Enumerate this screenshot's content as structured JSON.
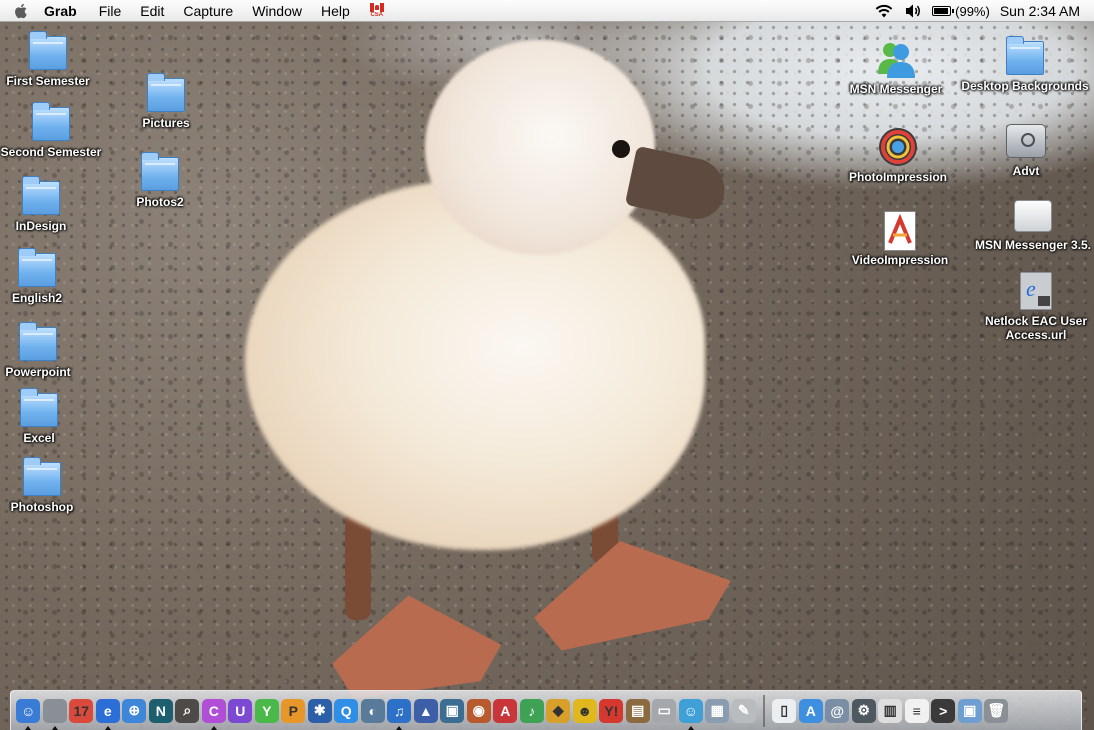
{
  "menubar": {
    "app_name": "Grab",
    "menus": [
      "File",
      "Edit",
      "Capture",
      "Window",
      "Help"
    ],
    "flag_label": "CSA",
    "battery": "(99%)",
    "battery_level": 0.99,
    "clock": "Sun 2:34 AM"
  },
  "desktop": {
    "left_icons": [
      {
        "label": "First Semester",
        "type": "folder"
      },
      {
        "label": "Second Semester",
        "type": "folder"
      },
      {
        "label": "InDesign",
        "type": "folder"
      },
      {
        "label": "English2",
        "type": "folder"
      },
      {
        "label": "Powerpoint",
        "type": "folder"
      },
      {
        "label": "Excel",
        "type": "folder"
      },
      {
        "label": "Photoshop",
        "type": "folder"
      },
      {
        "label": "Pictures",
        "type": "folder"
      },
      {
        "label": "Photos2",
        "type": "folder"
      }
    ],
    "right_icons": [
      {
        "label": "MSN Messenger",
        "type": "msn-alias"
      },
      {
        "label": "Desktop Backgrounds",
        "type": "folder"
      },
      {
        "label": "PhotoImpression",
        "type": "app-alias"
      },
      {
        "label": "Advt",
        "type": "hard-disk"
      },
      {
        "label": "VideoImpression",
        "type": "app-alias"
      },
      {
        "label": "MSN Messenger 3.5.",
        "type": "disk-image"
      },
      {
        "label": "Netlock EAC User Access.url",
        "type": "url-file"
      }
    ]
  },
  "dock": {
    "apps": [
      {
        "name": "finder-icon",
        "color": "#3a7bd5",
        "glyph": "☺"
      },
      {
        "name": "mail-icon",
        "color": "#8a8f95",
        "glyph": ""
      },
      {
        "name": "ical-icon",
        "color": "#d94a3c",
        "glyph": "17"
      },
      {
        "name": "internet-explorer-icon",
        "color": "#2b6fd6",
        "glyph": "e"
      },
      {
        "name": "safari-icon",
        "color": "#3e86d8",
        "glyph": "⊕"
      },
      {
        "name": "netscape-icon",
        "color": "#1d5f6e",
        "glyph": "N"
      },
      {
        "name": "sherlock-icon",
        "color": "#4d4a47",
        "glyph": "⌕"
      },
      {
        "name": "messenger-c-icon",
        "color": "#b04fd6",
        "glyph": "C"
      },
      {
        "name": "u-app-icon",
        "color": "#7b49d2",
        "glyph": "U"
      },
      {
        "name": "y-app-icon",
        "color": "#4bb84a",
        "glyph": "Y"
      },
      {
        "name": "p-app-icon",
        "color": "#e7962a",
        "glyph": "P"
      },
      {
        "name": "imovie-icon",
        "color": "#2b5fa8",
        "glyph": "✱"
      },
      {
        "name": "quicktime-icon",
        "color": "#2f8ee5",
        "glyph": "Q"
      },
      {
        "name": "network-icon",
        "color": "#5a7a9a",
        "glyph": "◐"
      },
      {
        "name": "itunes-icon",
        "color": "#2c70c7",
        "glyph": "♫"
      },
      {
        "name": "mountain-app-icon",
        "color": "#3d5fa8",
        "glyph": "▲"
      },
      {
        "name": "iphoto-icon",
        "color": "#3c6e93",
        "glyph": "▣"
      },
      {
        "name": "photo-viewer-icon",
        "color": "#b85a2e",
        "glyph": "◉"
      },
      {
        "name": "acrobat-icon",
        "color": "#c8363a",
        "glyph": "A"
      },
      {
        "name": "garageband-icon",
        "color": "#3fa153",
        "glyph": "♪"
      },
      {
        "name": "sign-icon",
        "color": "#d6a02a",
        "glyph": "◆"
      },
      {
        "name": "aim-icon",
        "color": "#e0b81e",
        "glyph": "☻"
      },
      {
        "name": "yahoo-messenger-icon",
        "color": "#d4382e",
        "glyph": "Y!"
      },
      {
        "name": "dictionary-icon",
        "color": "#8a6a3e",
        "glyph": "▤"
      },
      {
        "name": "printer-icon",
        "color": "#a4a7ab",
        "glyph": "▭"
      },
      {
        "name": "msn-messenger-icon",
        "color": "#3fa0d8",
        "glyph": "☺"
      },
      {
        "name": "preview-icon",
        "color": "#8a9cb0",
        "glyph": "▦"
      },
      {
        "name": "tool-icon",
        "color": "#b9bcbf",
        "glyph": "✎"
      }
    ],
    "docs": [
      {
        "name": "document-icon",
        "color": "#eceff2",
        "glyph": "▯"
      },
      {
        "name": "applications-folder-icon",
        "color": "#3f8fe0",
        "glyph": "A"
      },
      {
        "name": "internet-location-icon",
        "color": "#7a8fa6",
        "glyph": "@"
      },
      {
        "name": "utility-icon",
        "color": "#4e5861",
        "glyph": "⚙"
      },
      {
        "name": "piano-icon",
        "color": "#dedede",
        "glyph": "▥"
      },
      {
        "name": "text-doc-icon",
        "color": "#f1f1f1",
        "glyph": "≡"
      },
      {
        "name": "terminal-icon",
        "color": "#3a3a3a",
        "glyph": ">"
      },
      {
        "name": "finder-window-icon",
        "color": "#6f9fd0",
        "glyph": "▣"
      },
      {
        "name": "trash-icon",
        "color": "#8b9096",
        "glyph": "🗑"
      }
    ]
  }
}
